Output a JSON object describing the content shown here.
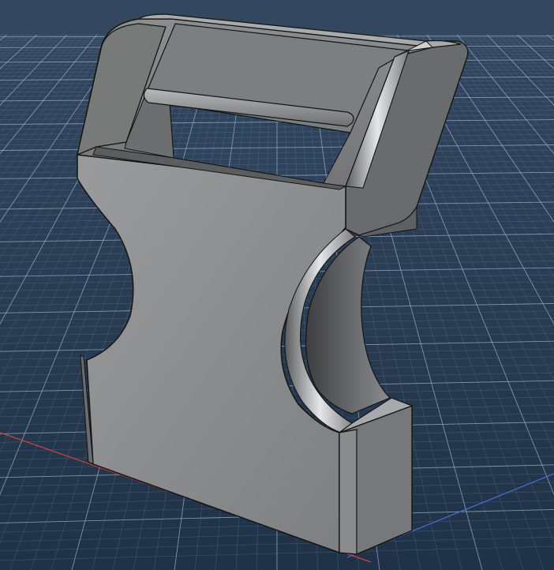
{
  "viewport": {
    "background_top": "#33475f",
    "background_bottom": "#203247",
    "grid_minor_color": "#6f8aa6",
    "grid_major_color": "#9cb3cb",
    "axis_x_color": "#d0413f",
    "axis_y_color": "#4a6fd6"
  },
  "model": {
    "kind": "buckle-clip",
    "face_color": "#8e8f90",
    "side_color": "#6a6b6c",
    "top_color": "#a8a9aa",
    "edge_color": "#141414"
  }
}
